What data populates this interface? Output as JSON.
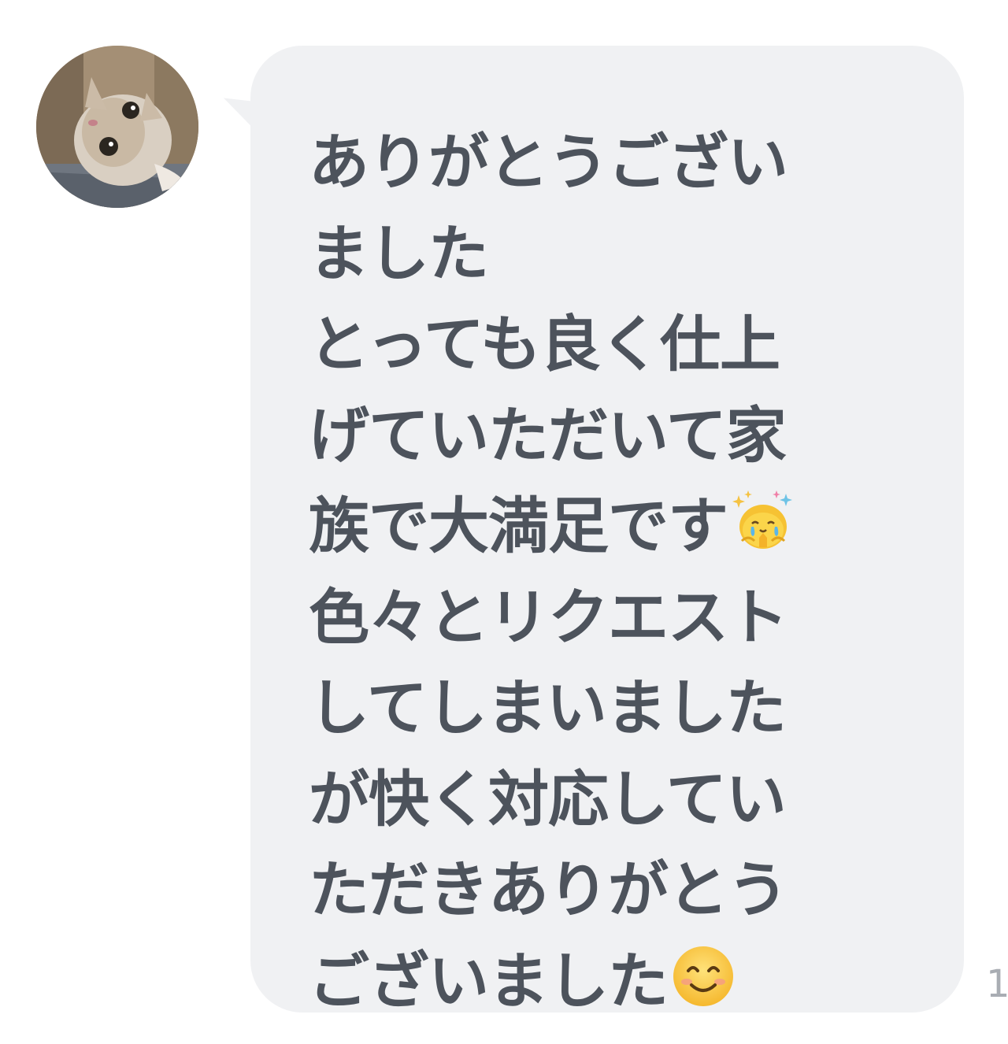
{
  "message": {
    "lines": [
      "ありがとうござい",
      "ました",
      "とっても良く仕上",
      "げていただいて家",
      "族で大満足です",
      "色々とリクエスト",
      "してしまいました",
      "が快く対応してい",
      "ただきありがとう",
      "ございました"
    ],
    "emoji_line5": "crying-face-praying-sparkles-icon",
    "emoji_line10": "smiling-face-icon",
    "bubble_color": "#f0f1f3",
    "text_color": "#4d535c"
  },
  "read_count": "1"
}
